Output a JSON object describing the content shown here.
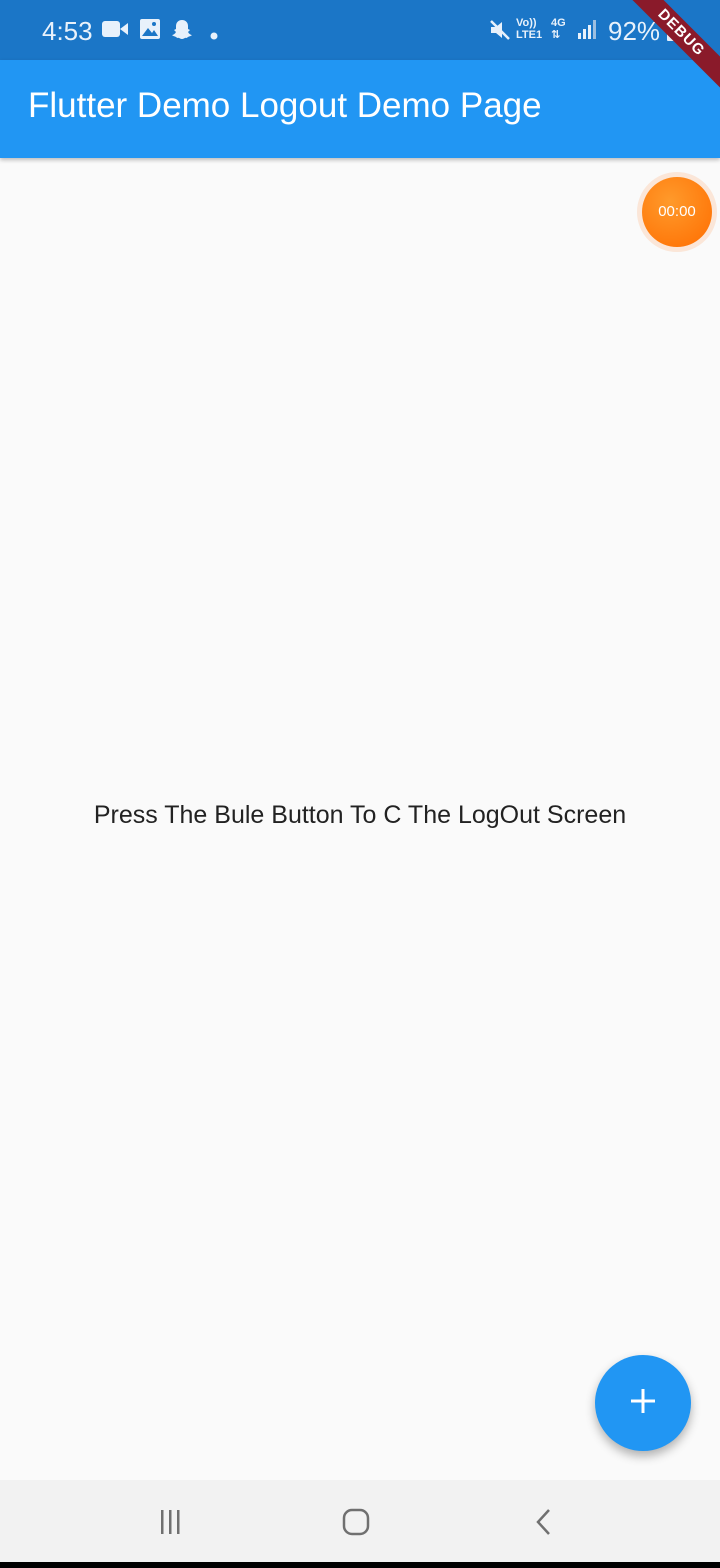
{
  "status_bar": {
    "time": "4:53",
    "battery": "92%",
    "icons": [
      "video-icon",
      "gallery-icon",
      "snapchat-icon",
      "dot-icon",
      "mute-icon",
      "volte-icon",
      "4g-icon",
      "signal-icon",
      "battery-icon"
    ],
    "network_label_top": "Vo))",
    "network_label_bottom": "LTE1",
    "data_label": "4G"
  },
  "app_bar": {
    "title": "Flutter Demo Logout Demo Page"
  },
  "debug_banner": {
    "label": "DEBUG"
  },
  "timer": {
    "label": "00:00"
  },
  "main": {
    "message": "Press The Bule Button To C The LogOut Screen"
  },
  "fab": {
    "icon": "plus-icon"
  },
  "nav_bar": {
    "buttons": [
      "recents-icon",
      "home-icon",
      "back-icon"
    ]
  },
  "colors": {
    "status_bar": "#1b76c7",
    "app_bar": "#2196f3",
    "fab": "#2196f3",
    "timer": "#ff6d00",
    "background": "#fafafa"
  }
}
